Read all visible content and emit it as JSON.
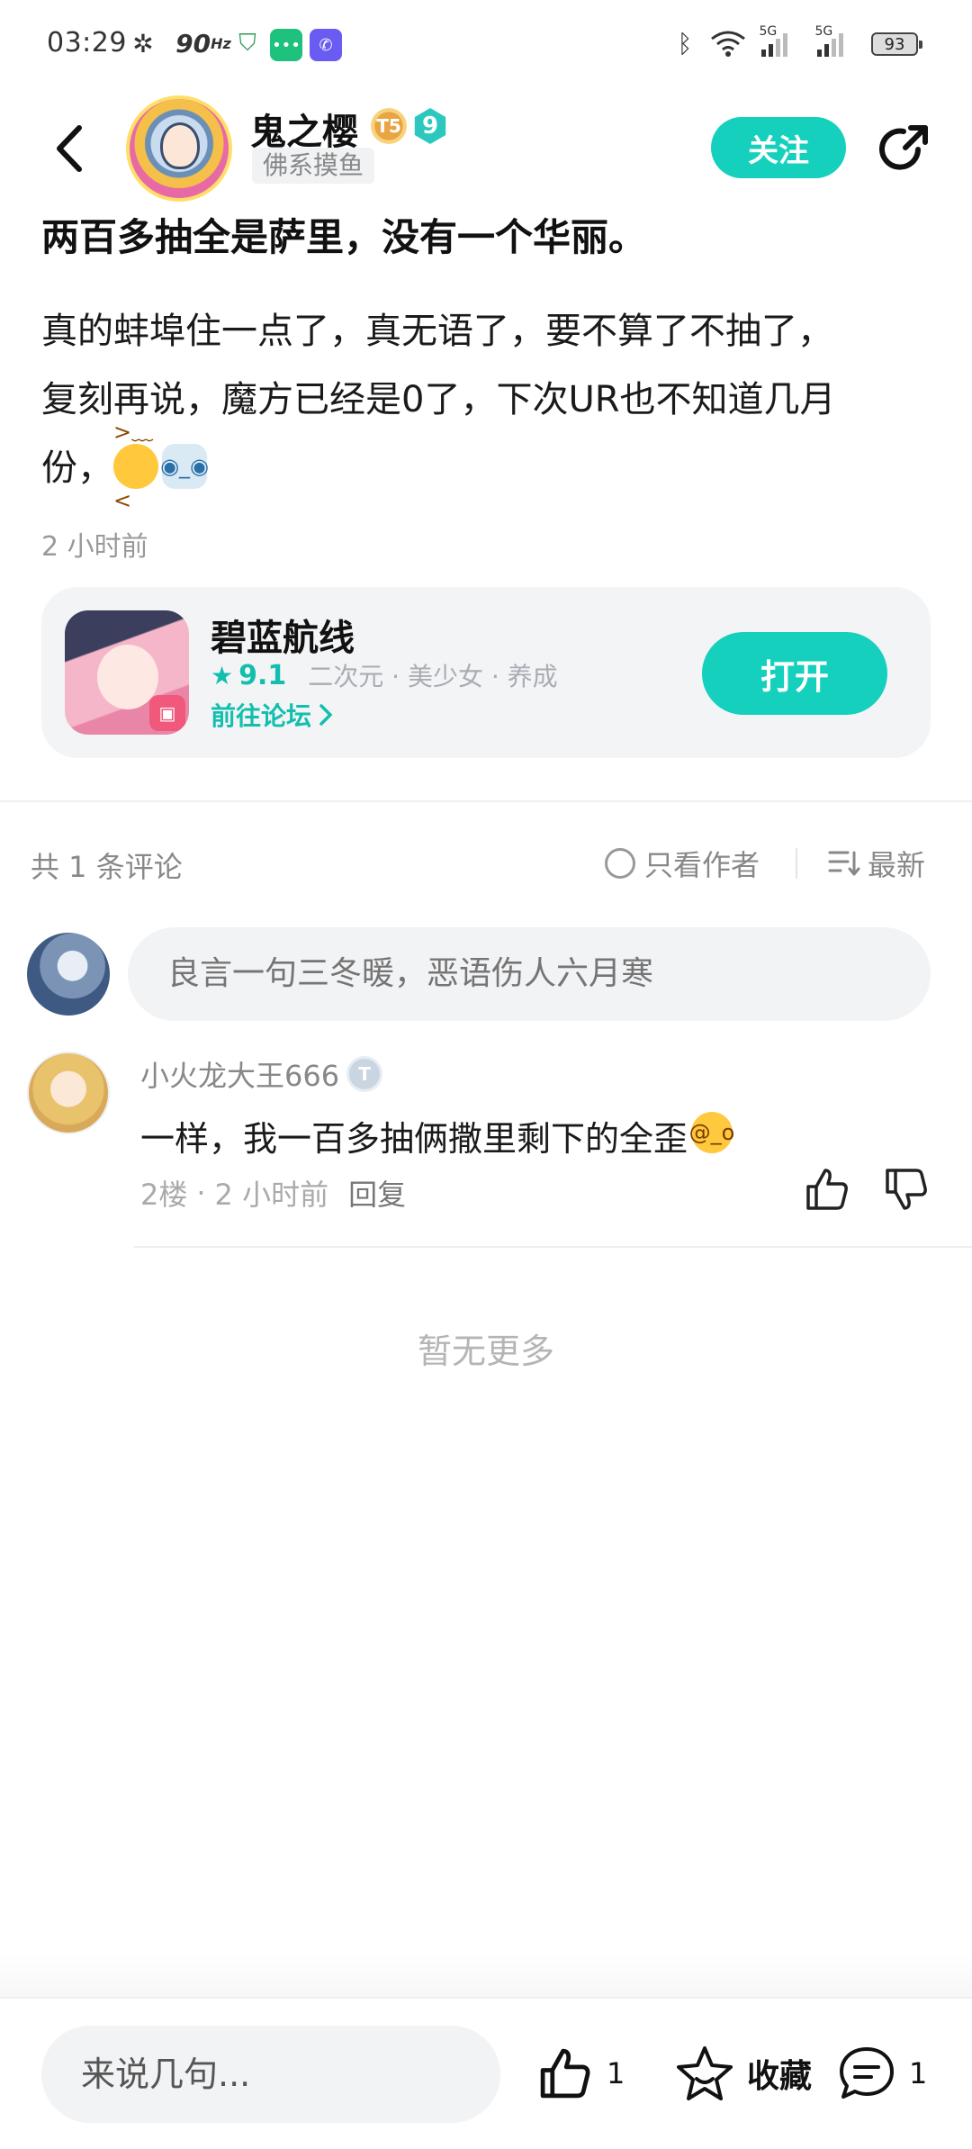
{
  "status_bar": {
    "time": "03:29",
    "refresh_rate": "90",
    "refresh_unit": "Hz",
    "network_1": "5G",
    "network_2": "5G",
    "battery": "93"
  },
  "header": {
    "author_name": "鬼之樱",
    "level_badge_1": "T5",
    "level_badge_2": "9",
    "author_tag": "佛系摸鱼",
    "follow_label": "关注"
  },
  "post": {
    "title": "两百多抽全是萨里，没有一个华丽。",
    "body_line_1": "真的蚌埠住一点了，真无语了，要不算了不抽了，",
    "body_line_2": "复刻再说，魔方已经是0了，下次UR也不知道几月",
    "body_line_3": "份，",
    "time": "2 小时前"
  },
  "game_card": {
    "name": "碧蓝航线",
    "rating": "9.1",
    "tags": "二次元 · 美少女 · 养成",
    "forum_link": "前往论坛",
    "open_label": "打开"
  },
  "comments_bar": {
    "count_text": "共 1 条评论",
    "author_only": "只看作者",
    "sort_label": "最新"
  },
  "comment_input": {
    "placeholder": "良言一句三冬暖，恶语伤人六月寒"
  },
  "comments": [
    {
      "username": "小火龙大王666",
      "text": "一样，我一百多抽俩撒里剩下的全歪",
      "floor": "2楼",
      "time": "2 小时前",
      "reply_label": "回复"
    }
  ],
  "no_more": "暂无更多",
  "bottom_bar": {
    "input_placeholder": "来说几句...",
    "like_count": "1",
    "favorite_label": "收藏",
    "comment_count": "1"
  },
  "colors": {
    "accent": "#14d0bd",
    "text_primary": "#111111",
    "text_secondary": "#888888"
  }
}
